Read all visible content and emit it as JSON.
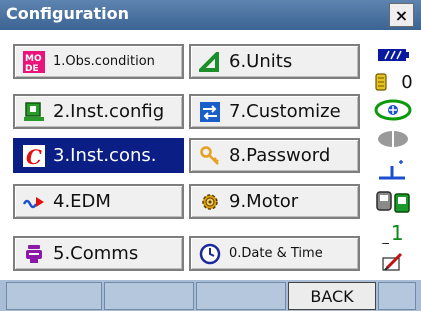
{
  "window": {
    "title": "Configuration",
    "close_label": "×"
  },
  "menu": [
    {
      "id": "obs",
      "label": "1.Obs.condition",
      "icon": "mode-icon",
      "selected": false
    },
    {
      "id": "units",
      "label": "6.Units",
      "icon": "triangle-icon",
      "selected": false
    },
    {
      "id": "instconfig",
      "label": "2.Inst.config",
      "icon": "instrument-icon",
      "selected": false
    },
    {
      "id": "customize",
      "label": "7.Customize",
      "icon": "arrows-icon",
      "selected": false
    },
    {
      "id": "instcons",
      "label": "3.Inst.cons.",
      "icon": "c-icon",
      "selected": true
    },
    {
      "id": "password",
      "label": "8.Password",
      "icon": "key-icon",
      "selected": false
    },
    {
      "id": "edm",
      "label": "4.EDM",
      "icon": "edm-icon",
      "selected": false
    },
    {
      "id": "motor",
      "label": "9.Motor",
      "icon": "gear-icon",
      "selected": false
    },
    {
      "id": "comms",
      "label": "5.Comms",
      "icon": "comms-icon",
      "selected": false
    },
    {
      "id": "datetime",
      "label": "0.Date & Time",
      "icon": "clock-icon",
      "selected": false
    }
  ],
  "status": {
    "battery_icon": "battery-icon",
    "memory_count": "0",
    "target_icon": "prism-target-icon",
    "laser_icon": "laser-icon",
    "tilt_icon": "tilt-icon",
    "connection_icon": "connection-icon",
    "input_mode": "1",
    "pen_icon": "pen-icon"
  },
  "softkeys": [
    "",
    "",
    "",
    "BACK",
    ""
  ],
  "colors": {
    "titlebar": "#3b6494",
    "selected": "#0a1e86",
    "softkey_bar": "#a9bed6"
  }
}
